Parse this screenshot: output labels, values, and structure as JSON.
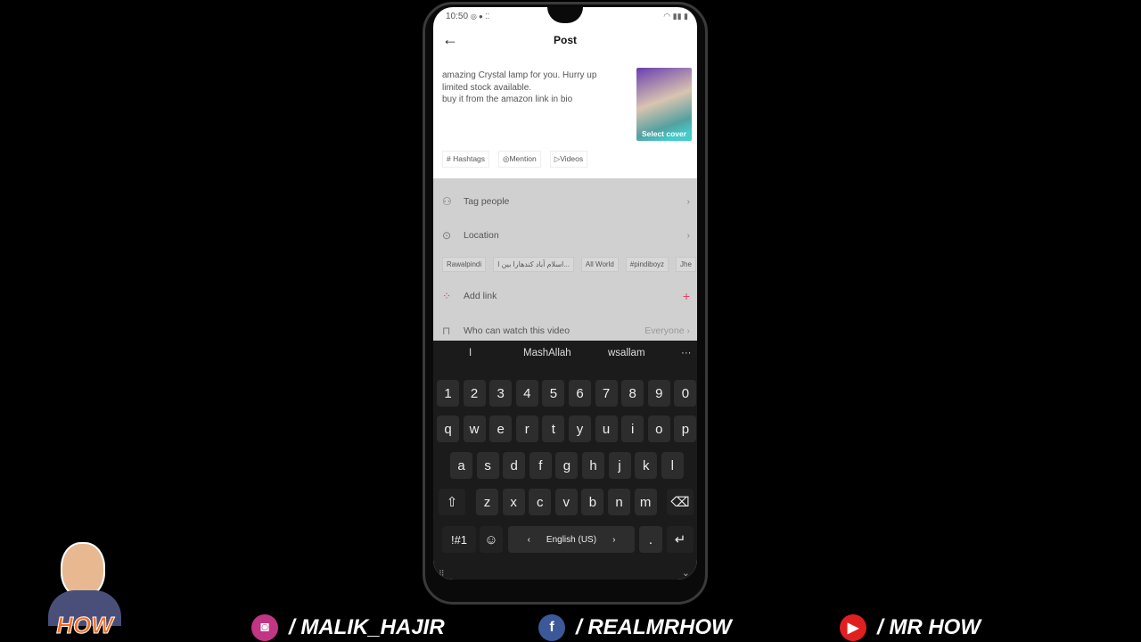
{
  "status": {
    "time": "10:50"
  },
  "header": {
    "title": "Post",
    "back": "←"
  },
  "caption": [
    "amazing Crystal lamp for you. Hurry up",
    "limited stock available.",
    "buy it from the amazon link in bio"
  ],
  "cover": {
    "label": "Select cover"
  },
  "chips": [
    {
      "icon": "#",
      "label": "Hashtags"
    },
    {
      "icon": "◎",
      "label": "Mention"
    },
    {
      "icon": "▷",
      "label": "Videos"
    }
  ],
  "rows": {
    "tag_people": "Tag people",
    "location": "Location",
    "add_link": "Add link",
    "who_can_watch": "Who can watch this video",
    "who_value": "Everyone"
  },
  "location_tags": [
    "Rawalpindi",
    "اسلام آباد کندھارا بین ا...",
    "All World",
    "#pindiboyz",
    "Jhe"
  ],
  "keyboard": {
    "suggestions": [
      "I",
      "MashAllah",
      "wsallam"
    ],
    "numbers": [
      "1",
      "2",
      "3",
      "4",
      "5",
      "6",
      "7",
      "8",
      "9",
      "0"
    ],
    "row1": [
      "q",
      "w",
      "e",
      "r",
      "t",
      "y",
      "u",
      "i",
      "o",
      "p"
    ],
    "row2": [
      "a",
      "s",
      "d",
      "f",
      "g",
      "h",
      "j",
      "k",
      "l"
    ],
    "row3": [
      "z",
      "x",
      "c",
      "v",
      "b",
      "n",
      "m"
    ],
    "symbols": "!#1",
    "language": "English (US)",
    "period": "."
  },
  "footer": {
    "instagram": "/ MALIK_HAJIR",
    "facebook": "/ REALMRHOW",
    "youtube": "/ MR HOW",
    "logo_text": "MR HOW"
  },
  "colors": {
    "instagram": "#c13584",
    "facebook": "#3b5998",
    "youtube": "#e02020",
    "add_plus": "#e0406a"
  }
}
